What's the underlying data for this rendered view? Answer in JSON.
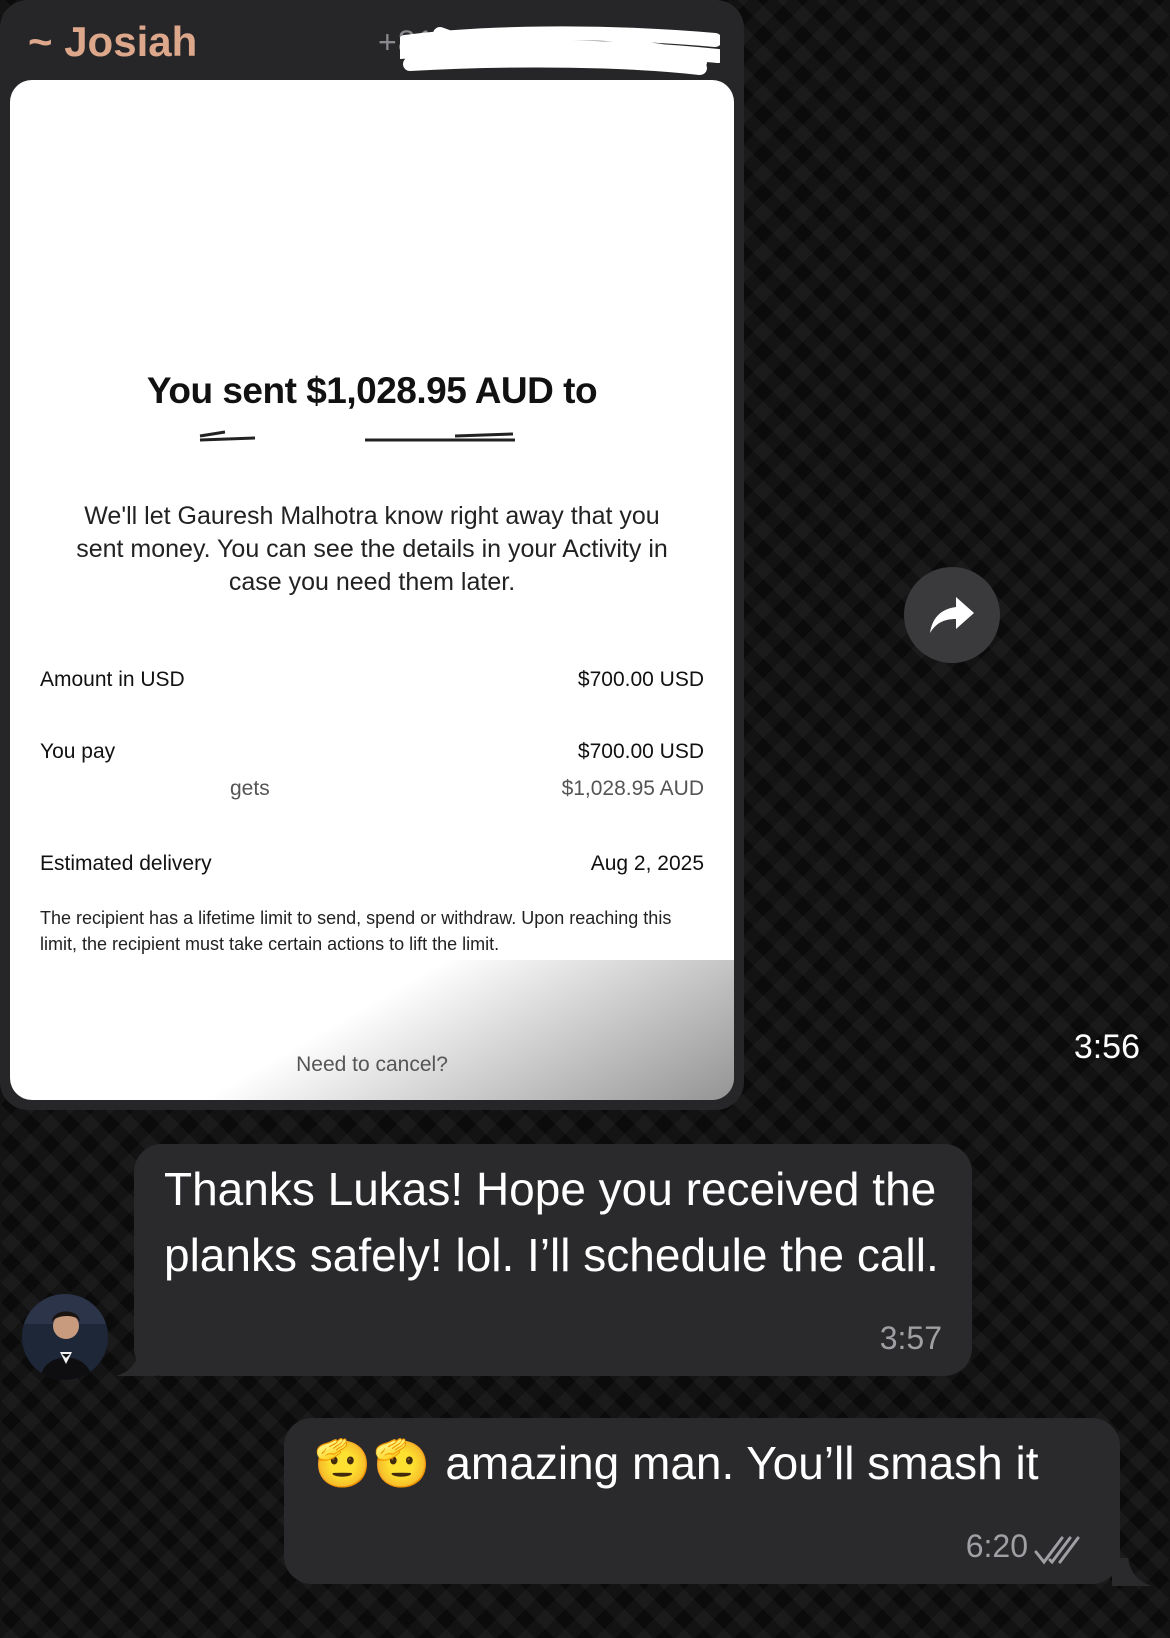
{
  "incoming_image_message": {
    "sender_name": "~ Josiah",
    "sender_phone": "+81",
    "time": "3:56",
    "receipt": {
      "title": "You sent $1,028.95 AUD to",
      "note": "We'll let Gauresh Malhotra know right away that you sent money. You can see the details in your Activity in case you need them later.",
      "rows": [
        {
          "label": "Amount in USD",
          "value": "$700.00 USD"
        },
        {
          "label": "You pay",
          "value": "$700.00 USD"
        },
        {
          "label": "gets",
          "value": "$1,028.95 AUD"
        },
        {
          "label": "Estimated delivery",
          "value": "Aug 2, 2025"
        }
      ],
      "limit_note": "The recipient has a lifetime limit to send, spend or withdraw. Upon reaching this limit, the recipient must take certain actions to lift the limit.",
      "cancel_link": "Need to cancel?"
    }
  },
  "incoming_text_message": {
    "text": "Thanks Lukas! Hope you received the planks safely! lol. I’ll schedule the call.",
    "time": "3:57"
  },
  "outgoing_text_message": {
    "emoji": "🫡🫡",
    "text": "amazing man. You’ll smash it",
    "time": "6:20"
  },
  "icons": {
    "forward": "forward-arrow-icon",
    "read_receipt": "double-check-icon",
    "emoji": "saluting-face-emoji"
  },
  "colors": {
    "sender_name": "#dca78a",
    "bubble": "#2a2a2c",
    "background": "#0b0b0b"
  }
}
